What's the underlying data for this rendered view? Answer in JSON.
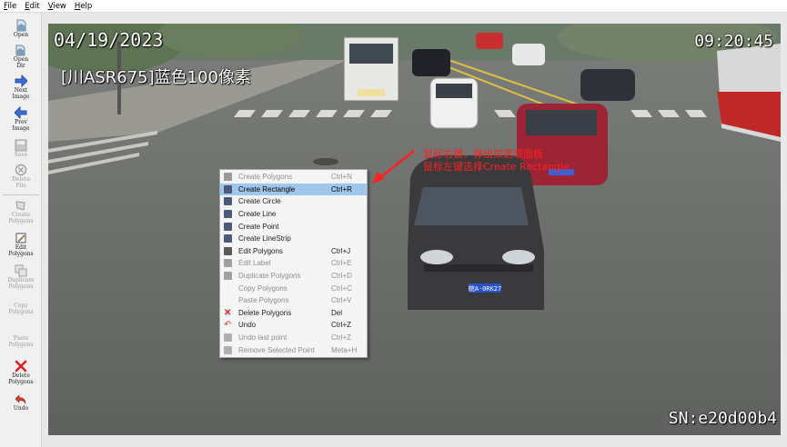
{
  "menu": [
    "File",
    "Edit",
    "View",
    "Help"
  ],
  "toolbar": {
    "open": "Open",
    "open_dir": [
      "Open",
      "Dir"
    ],
    "next_image": [
      "Next",
      "Image"
    ],
    "prev_image": [
      "Prev",
      "Image"
    ],
    "save": "Save",
    "delete_file": [
      "Delete",
      "File"
    ],
    "create_polygons": [
      "Create",
      "Polygons"
    ],
    "edit_polygons": [
      "Edit",
      "Polygons"
    ],
    "duplicate_polygons": [
      "Duplicate",
      "Polygons"
    ],
    "copy_polygons": [
      "Copy",
      "Polygons"
    ],
    "paste_polygons": [
      "Paste",
      "Polygons"
    ],
    "delete_polygons": [
      "Delete",
      "Polygons"
    ],
    "undo": "Undo"
  },
  "image": {
    "date": "04/19/2023",
    "time": "09:20:45",
    "plate_label": "[川ASR675]蓝色100像素",
    "serial": "SN:e20d00b4",
    "car_plate": "皖A·0RK27",
    "annotation_line1": "鼠标右键，弹出如选项面板",
    "annotation_line2": "鼠标左键选择Create Rectangle"
  },
  "context_menu": [
    {
      "label": "Create Polygons",
      "shortcut": "Ctrl+N",
      "disabled": true,
      "active": false,
      "icon": "create-polygons-icon",
      "color": "#9a9a9a"
    },
    {
      "label": "Create Rectangle",
      "shortcut": "Ctrl+R",
      "disabled": false,
      "active": true,
      "icon": "create-rectangle-icon",
      "color": "#4a5a7a"
    },
    {
      "label": "Create Circle",
      "shortcut": "",
      "disabled": false,
      "active": false,
      "icon": "create-circle-icon",
      "color": "#4a5a7a"
    },
    {
      "label": "Create Line",
      "shortcut": "",
      "disabled": false,
      "active": false,
      "icon": "create-line-icon",
      "color": "#4a5a7a"
    },
    {
      "label": "Create Point",
      "shortcut": "",
      "disabled": false,
      "active": false,
      "icon": "create-point-icon",
      "color": "#4a5a7a"
    },
    {
      "label": "Create LineStrip",
      "shortcut": "",
      "disabled": false,
      "active": false,
      "icon": "create-linestrip-icon",
      "color": "#4a5a7a"
    },
    {
      "label": "Edit Polygons",
      "shortcut": "Ctrl+J",
      "disabled": false,
      "active": false,
      "icon": "edit-polygons-icon",
      "color": "#5a5a5a"
    },
    {
      "label": "Edit Label",
      "shortcut": "Ctrl+E",
      "disabled": true,
      "active": false,
      "icon": "edit-label-icon",
      "color": "#a0a0a0"
    },
    {
      "label": "Duplicate Polygons",
      "shortcut": "Ctrl+D",
      "disabled": true,
      "active": false,
      "icon": "duplicate-polygons-icon",
      "color": "#a0a0a0"
    },
    {
      "label": "Copy Polygons",
      "shortcut": "Ctrl+C",
      "disabled": true,
      "active": false,
      "icon": "",
      "color": ""
    },
    {
      "label": "Paste Polygons",
      "shortcut": "Ctrl+V",
      "disabled": true,
      "active": false,
      "icon": "",
      "color": ""
    },
    {
      "label": "Delete Polygons",
      "shortcut": "Del",
      "disabled": false,
      "active": false,
      "icon": "delete-polygons-icon",
      "color": "#e02020"
    },
    {
      "label": "Undo",
      "shortcut": "Ctrl+Z",
      "disabled": false,
      "active": false,
      "icon": "undo-icon",
      "color": "#d04030"
    },
    {
      "label": "Undo last point",
      "shortcut": "Ctrl+Z",
      "disabled": true,
      "active": false,
      "icon": "undo-last-point-icon",
      "color": "#b0b0b0"
    },
    {
      "label": "Remove Selected Point",
      "shortcut": "Meta+H",
      "disabled": true,
      "active": false,
      "icon": "remove-selected-point-icon",
      "color": "#b0b0b0"
    }
  ],
  "colors": {
    "menu_highlight": "#9fc6ec",
    "annotation_red": "#ff2020",
    "toolbar_bg": "#f0f0f0"
  }
}
